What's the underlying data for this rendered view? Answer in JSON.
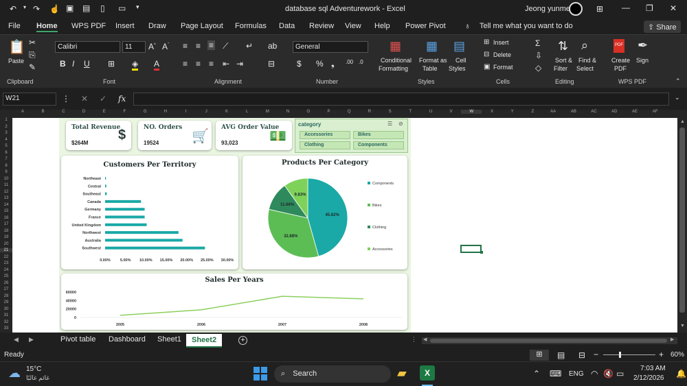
{
  "window": {
    "title": "database sql Adventurework  -  Excel",
    "user": "Jeong yunme"
  },
  "ribbon_tabs": [
    "File",
    "Home",
    "WPS PDF",
    "Insert",
    "Draw",
    "Page Layout",
    "Formulas",
    "Data",
    "Review",
    "View",
    "Help",
    "Power Pivot"
  ],
  "tell_me": "Tell me what you want to do",
  "share": "Share",
  "ribbon": {
    "paste": "Paste",
    "font_name": "Calibri",
    "font_size": "11",
    "number_format": "General",
    "conditional": "Conditional",
    "formatting": "Formatting",
    "format_as": "Format as",
    "table": "Table",
    "cell": "Cell",
    "styles": "Styles",
    "insert": "Insert",
    "delete": "Delete",
    "format": "Format",
    "sort": "Sort &",
    "filter": "Filter",
    "find": "Find &",
    "select": "Select",
    "create": "Create",
    "pdf": "PDF",
    "sign": "Sign",
    "groups": [
      "Clipboard",
      "Font",
      "Alignment",
      "Number",
      "Styles",
      "Cells",
      "Editing",
      "WPS PDF"
    ]
  },
  "name_box": "W21",
  "fx": "fx",
  "columns": [
    "A",
    "B",
    "C",
    "D",
    "E",
    "F",
    "G",
    "H",
    "I",
    "J",
    "K",
    "L",
    "M",
    "N",
    "O",
    "P",
    "Q",
    "R",
    "S",
    "T",
    "U",
    "V",
    "W",
    "X",
    "Y",
    "Z",
    "AA",
    "AB",
    "AC",
    "AD",
    "AE",
    "AF"
  ],
  "rows": [
    "1",
    "2",
    "3",
    "4",
    "5",
    "6",
    "7",
    "8",
    "9",
    "10",
    "11",
    "12",
    "13",
    "14",
    "15",
    "16",
    "17",
    "18",
    "19",
    "20",
    "21",
    "22",
    "23",
    "24",
    "25",
    "26",
    "27",
    "28",
    "29",
    "30",
    "31",
    "32",
    "33"
  ],
  "kpis": [
    {
      "title": "Total  Revenue",
      "value": "$264M",
      "icon": "dollar-icon"
    },
    {
      "title": "NO. Orders",
      "value": "19524",
      "icon": "cart-icon"
    },
    {
      "title": "AVG Order Value",
      "value": "93,023",
      "icon": "money-icon"
    }
  ],
  "slicer": {
    "title": "category",
    "items": [
      "Accessories",
      "Bikes",
      "Clothing",
      "Components"
    ]
  },
  "colors": {
    "teal": "#1aa9a6",
    "green": "#5dbd55",
    "light": "#7ed25a",
    "dark": "#2e8a5c",
    "line": "#8ccf5d",
    "dash": "#eaf6e2"
  },
  "chart_data": [
    {
      "type": "bar",
      "title": "Customers Per Territory",
      "categories": [
        "Northeast",
        "Central",
        "Southeast",
        "Canada",
        "Germany",
        "France",
        "United Kingdom",
        "Northwest",
        "Australia",
        "Southwest"
      ],
      "values": [
        0.2,
        0.3,
        0.4,
        8.8,
        9.7,
        9.7,
        10.2,
        18.0,
        19.0,
        24.5
      ],
      "xticks": [
        "0.00%",
        "5.00%",
        "10.00%",
        "15.00%",
        "20.00%",
        "25.00%",
        "30.00%"
      ],
      "xlim": [
        0,
        30
      ]
    },
    {
      "type": "pie",
      "title": "Products Per Category",
      "slices": [
        {
          "name": "Components",
          "value": 45.62
        },
        {
          "name": "Bikes",
          "value": 32.88
        },
        {
          "name": "Clothing",
          "value": 11.66
        },
        {
          "name": "Accessories",
          "value": 9.83
        }
      ],
      "labels": [
        "45.62%",
        "32.88%",
        "11.66%",
        "9.83%"
      ]
    },
    {
      "type": "line",
      "title": "Sales Per Years",
      "x": [
        "2005",
        "2006",
        "2007",
        "2008"
      ],
      "values": [
        5000,
        18000,
        50000,
        44000
      ],
      "yticks": [
        "60000",
        "40000",
        "20000",
        "0"
      ],
      "ylim": [
        0,
        60000
      ]
    }
  ],
  "sheets": [
    "Pivot table",
    "Dashboard",
    "Sheet1",
    "Sheet2"
  ],
  "active_sheet": "Sheet2",
  "status": {
    "ready": "Ready",
    "zoom": "60%"
  },
  "taskbar": {
    "temp": "15°C",
    "weather": "غائم غالبًا",
    "search": "Search",
    "lang": "ENG",
    "time": "7:03 AM",
    "date": "2/12/2026"
  }
}
